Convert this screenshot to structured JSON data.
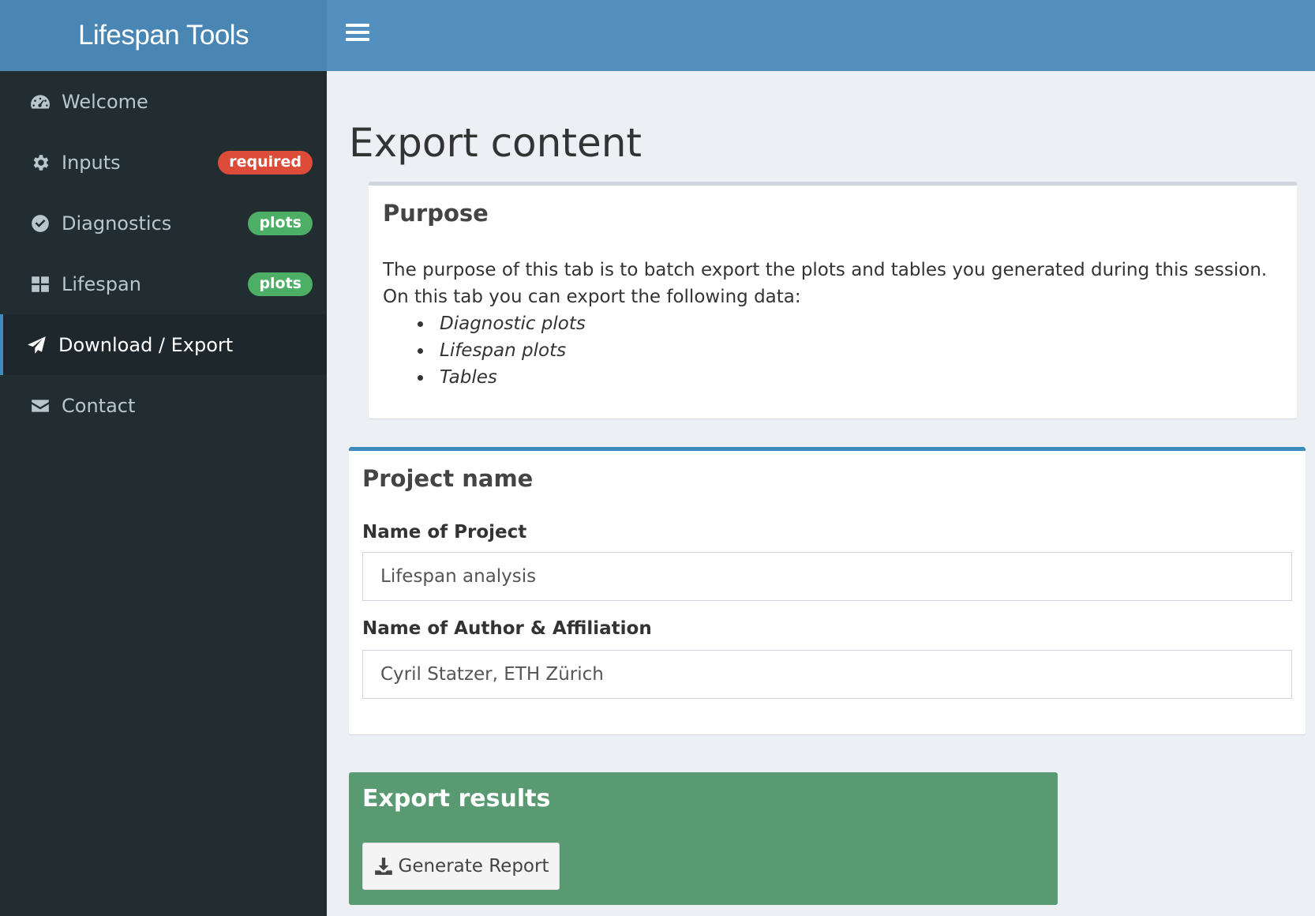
{
  "header": {
    "logo": "Lifespan Tools",
    "toggle_icon": "hamburger-icon"
  },
  "sidebar": {
    "items": [
      {
        "label": "Welcome",
        "icon": "dashboard-icon",
        "badge": ""
      },
      {
        "label": "Inputs",
        "icon": "gear-icon",
        "badge": "required",
        "badge_color": "#dd4b39"
      },
      {
        "label": "Diagnostics",
        "icon": "check-circle-icon",
        "badge": "plots",
        "badge_color": "#4caf65"
      },
      {
        "label": "Lifespan",
        "icon": "grid-icon",
        "badge": "plots",
        "badge_color": "#4caf65"
      },
      {
        "label": "Download / Export",
        "icon": "paper-plane-icon",
        "badge": "",
        "active": true
      },
      {
        "label": "Contact",
        "icon": "envelope-icon",
        "badge": ""
      }
    ]
  },
  "main": {
    "title": "Export content",
    "purpose": {
      "title": "Purpose",
      "text": "The purpose of this tab is to batch export the plots and tables you generated during this session. On this tab you can export the following data:",
      "items": [
        "Diagnostic plots",
        "Lifespan plots",
        "Tables"
      ]
    },
    "project": {
      "title": "Project name",
      "name_label": "Name of Project",
      "name_value": "Lifespan analysis",
      "author_label": "Name of Author & Affiliation",
      "author_value": "Cyril Statzer, ETH Zürich"
    },
    "export": {
      "title": "Export results",
      "button_label": "Generate Report",
      "button_icon": "download-icon"
    }
  },
  "colors": {
    "header_logo": "#4a86b4",
    "header_bar": "#5490bf",
    "sidebar": "#222d32",
    "export_box": "#5a9a73"
  }
}
